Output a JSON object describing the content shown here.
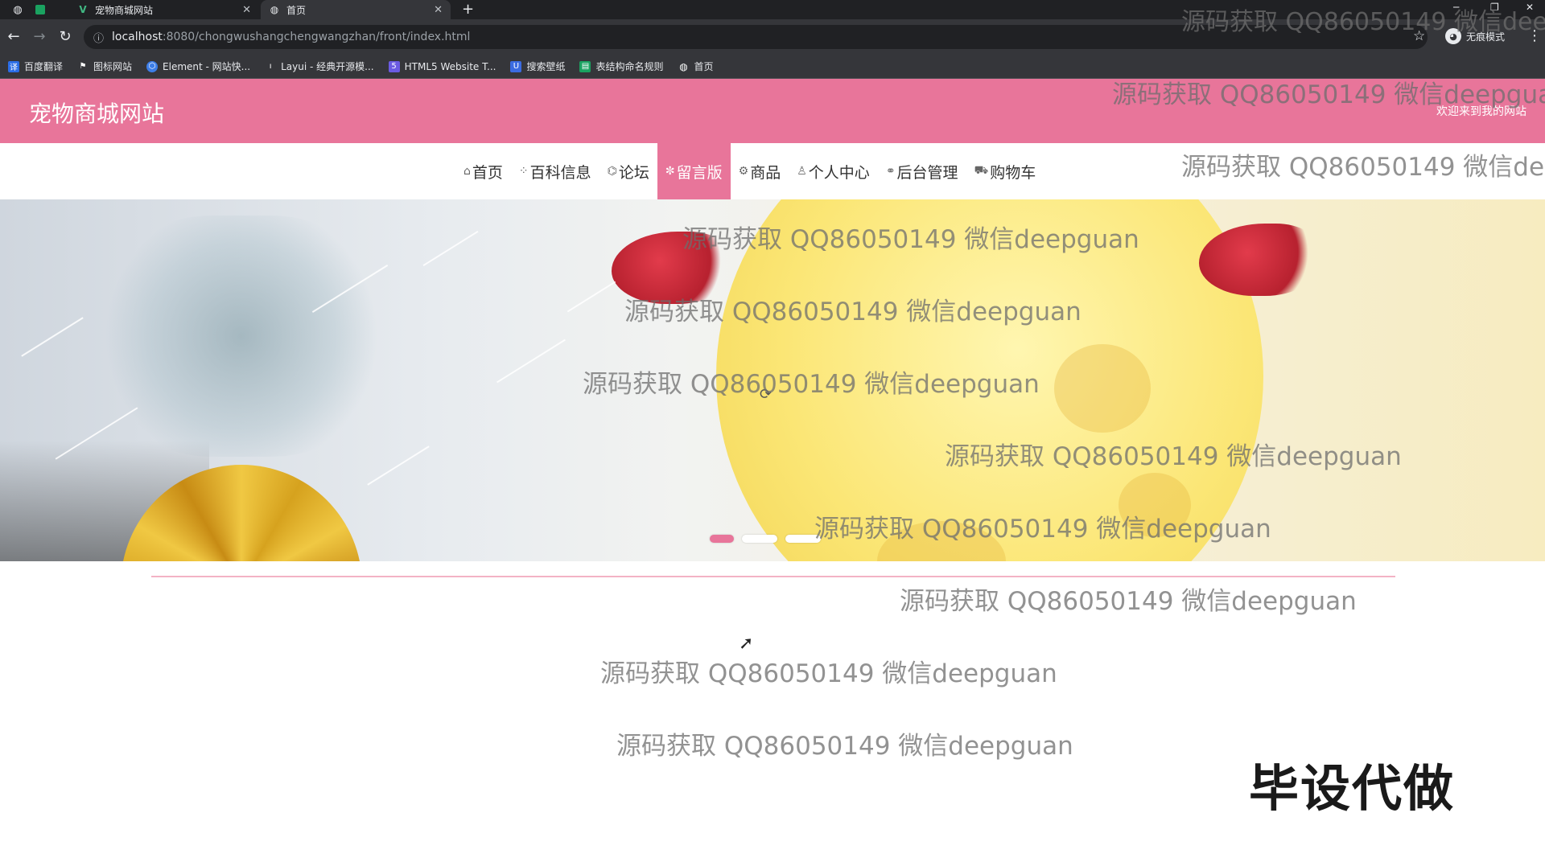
{
  "browser": {
    "tabs": [
      {
        "title": "宠物商城网站",
        "favicon": "vue-v-icon",
        "active": false
      },
      {
        "title": "首页",
        "favicon": "globe-icon",
        "active": true
      }
    ],
    "new_tab": "+",
    "address": {
      "host": "localhost",
      "path": ":8080/chongwushangchengwangzhan/front/index.html"
    },
    "profile_label": "无痕模式",
    "bookmarks": [
      {
        "label": "百度翻译",
        "color": "#2b6de6"
      },
      {
        "label": "图标网站",
        "color": "#444444"
      },
      {
        "label": "Element - 网站快...",
        "color": "#3d7ee8"
      },
      {
        "label": "Layui - 经典开源模...",
        "color": "#444444"
      },
      {
        "label": "HTML5 Website T...",
        "color": "#6b5be2"
      },
      {
        "label": "搜索壁纸",
        "color": "#3b6be0"
      },
      {
        "label": "表结构命名规则",
        "color": "#1aa260"
      },
      {
        "label": "首页",
        "color": "#666666"
      }
    ]
  },
  "site": {
    "title": "宠物商城网站",
    "welcome": "欢迎来到我的网站",
    "accent": "#e8759a",
    "nav": [
      {
        "label": "首页",
        "icon": "home-icon",
        "glyph": "⌂",
        "active": false
      },
      {
        "label": "百科信息",
        "icon": "grid-icon",
        "glyph": "⁘",
        "active": false
      },
      {
        "label": "论坛",
        "icon": "tag-icon",
        "glyph": "⌬",
        "active": false
      },
      {
        "label": "留言版",
        "icon": "flower-icon",
        "glyph": "✼",
        "active": true
      },
      {
        "label": "商品",
        "icon": "gear-icon",
        "glyph": "⚙",
        "active": false
      },
      {
        "label": "个人中心",
        "icon": "user-icon",
        "glyph": "♙",
        "active": false
      },
      {
        "label": "后台管理",
        "icon": "link-icon",
        "glyph": "⚭",
        "active": false
      },
      {
        "label": "购物车",
        "icon": "cart-icon",
        "glyph": "⛟",
        "active": false
      }
    ],
    "slider": {
      "count": 3,
      "active_index": 0
    }
  },
  "overlay": {
    "watermark": "源码获取 QQ86050149 微信deepguan",
    "watermark_top_right": "源码获取 QQ86050149 微信deep",
    "stamp": "毕设代做"
  }
}
